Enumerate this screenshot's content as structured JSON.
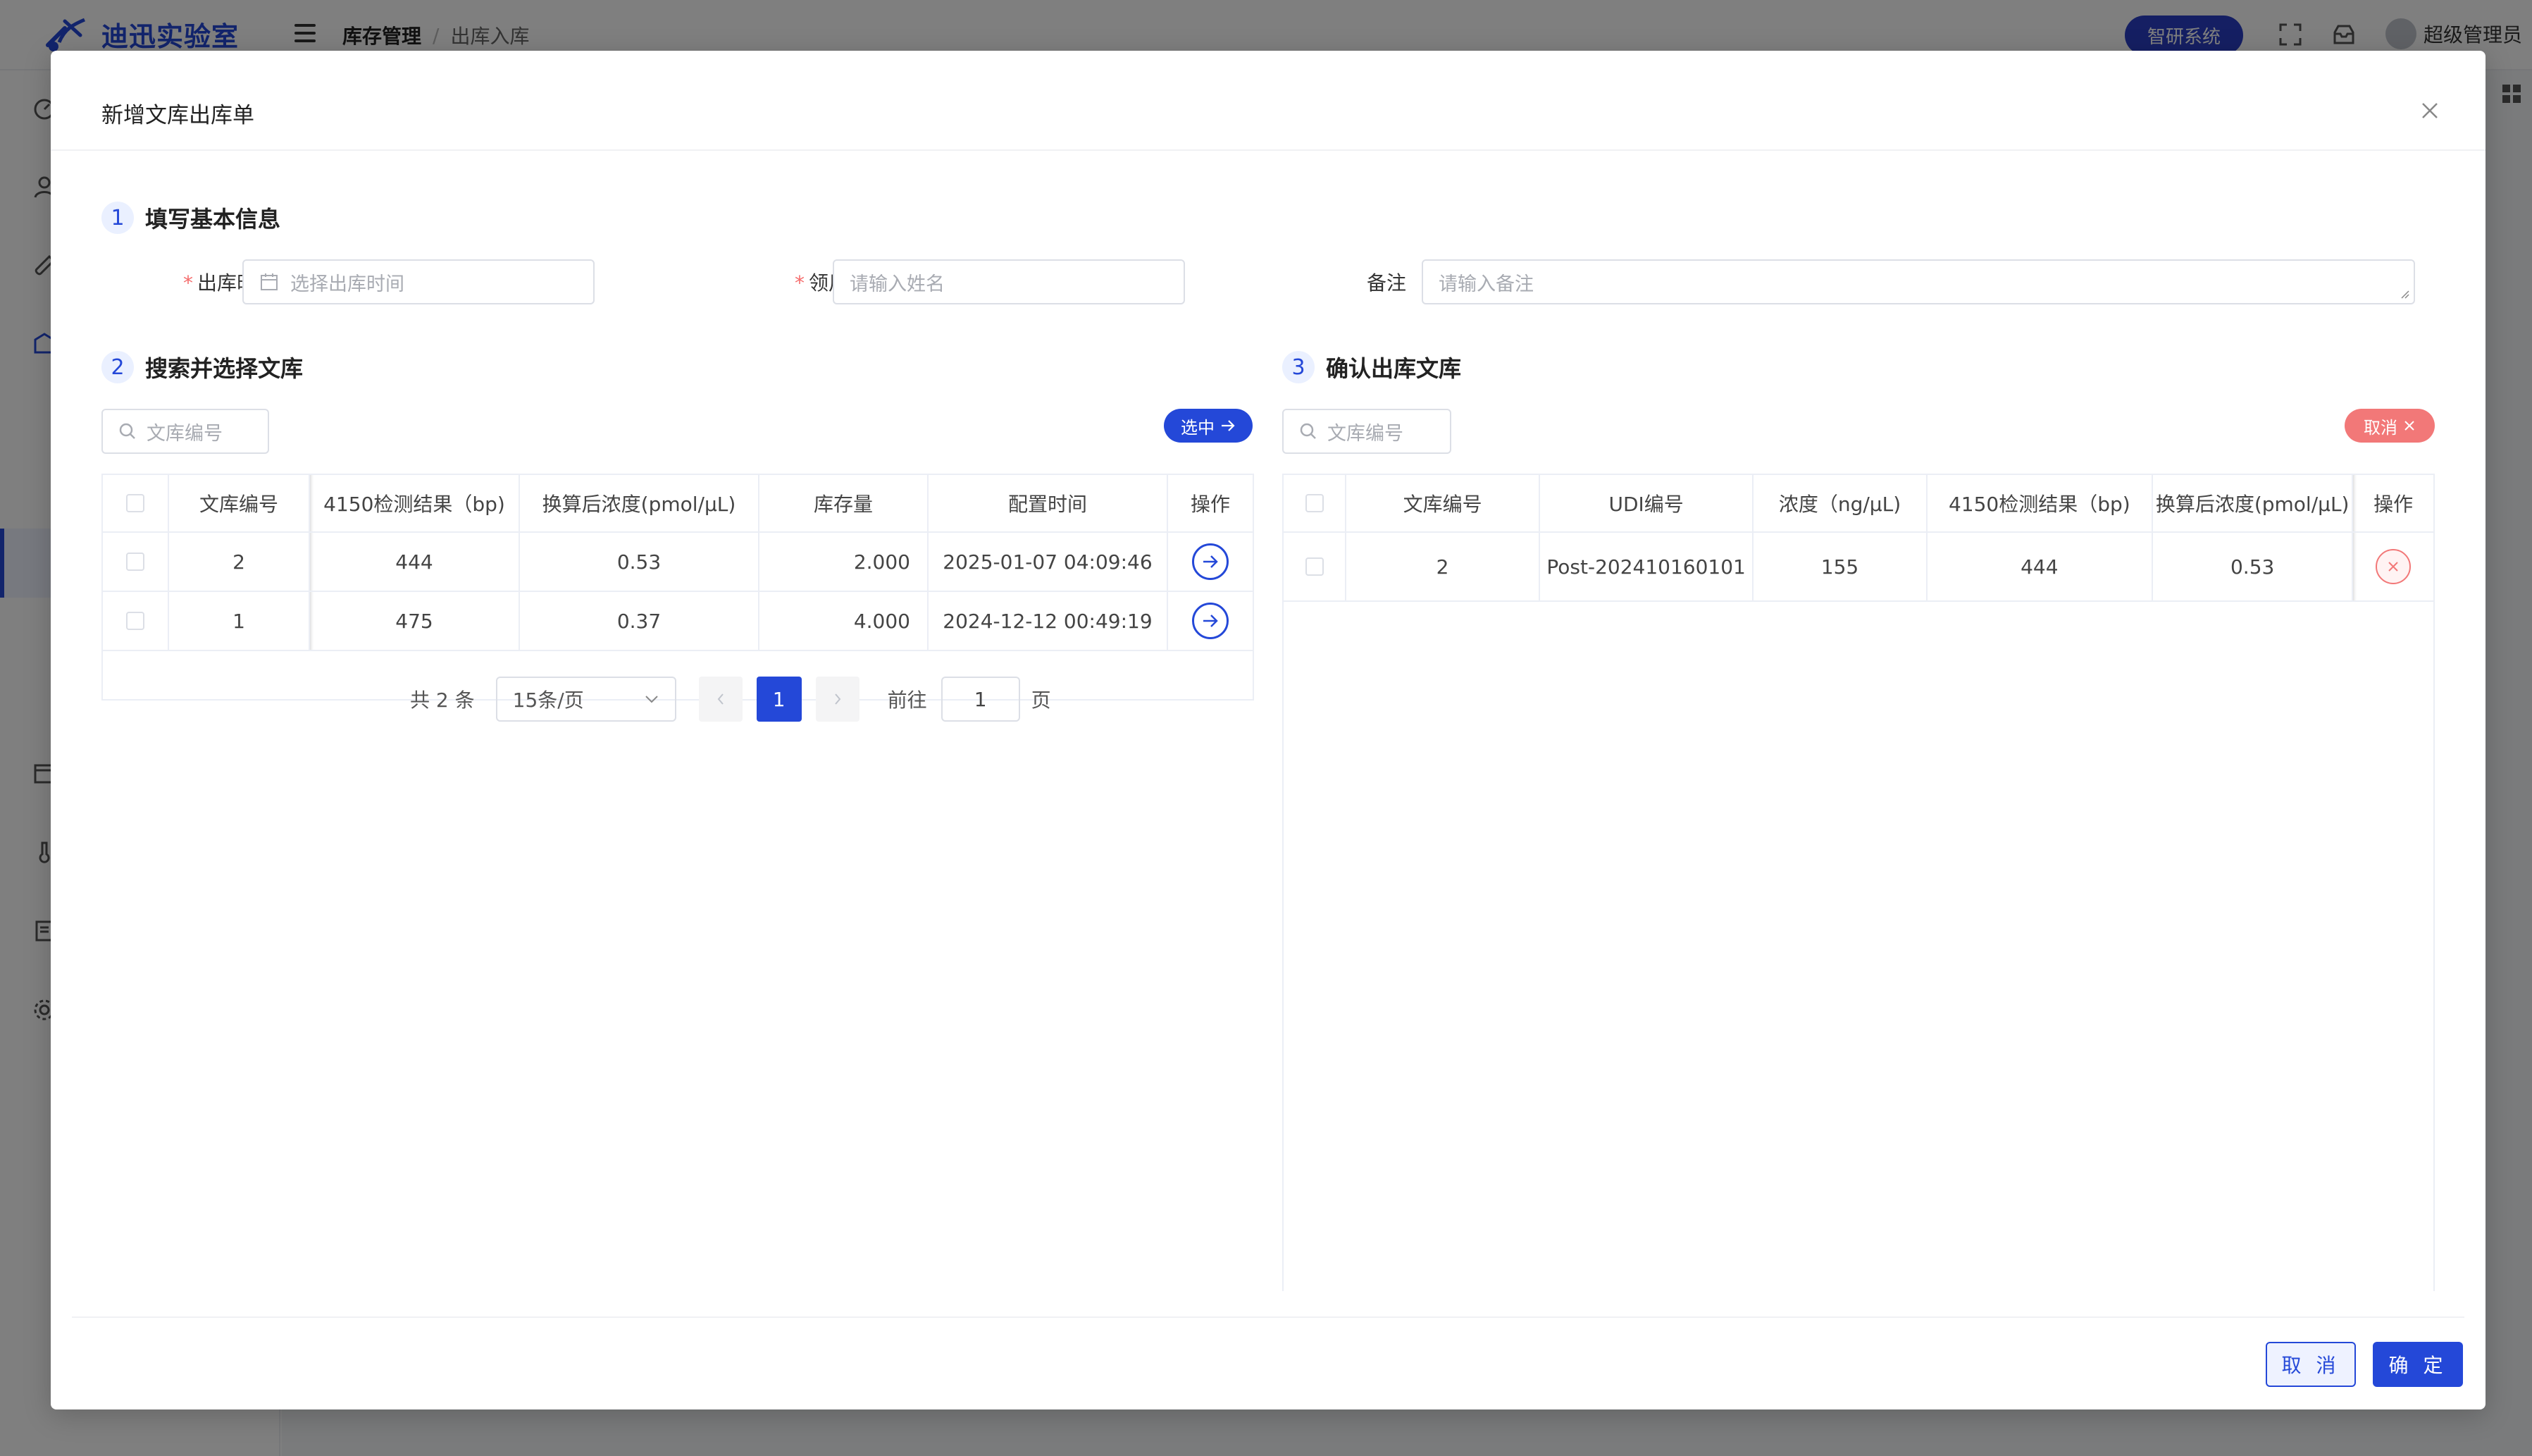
{
  "app": {
    "logo_text": "迪迅实验室",
    "breadcrumb": {
      "root": "库存管理",
      "separator": "/",
      "current": "出库入库"
    },
    "system_button": "智研系统",
    "user_name": "超级管理员"
  },
  "dialog": {
    "title": "新增文库出库单",
    "section1": {
      "step": "1",
      "title": "填写基本信息"
    },
    "form": {
      "out_time_label": "出库时间",
      "out_time_placeholder": "选择出库时间",
      "recipient_label": "领用人",
      "recipient_placeholder": "请输入姓名",
      "remark_label": "备注",
      "remark_placeholder": "请输入备注",
      "required_mark": "*"
    },
    "section2": {
      "step": "2",
      "title": "搜索并选择文库",
      "search_placeholder": "文库编号",
      "select_button": "选中",
      "columns": [
        "文库编号",
        "4150检测结果（bp)",
        "换算后浓度(pmol/μL)",
        "库存量",
        "配置时间",
        "操作"
      ],
      "rows": [
        {
          "id": "2",
          "result": "444",
          "conc": "0.53",
          "stock": "2.000",
          "time": "2025-01-07 04:09:46"
        },
        {
          "id": "1",
          "result": "475",
          "conc": "0.37",
          "stock": "4.000",
          "time": "2024-12-12 00:49:19"
        }
      ],
      "pagination": {
        "total": "共 2 条",
        "page_size": "15条/页",
        "current": "1",
        "goto_label": "前往",
        "goto_value": "1",
        "page_suffix": "页"
      }
    },
    "section3": {
      "step": "3",
      "title": "确认出库文库",
      "search_placeholder": "文库编号",
      "cancel_button": "取消",
      "columns": [
        "文库编号",
        "UDI编号",
        "浓度（ng/μL)",
        "4150检测结果（bp)",
        "换算后浓度(pmol/μL)",
        "操作"
      ],
      "rows": [
        {
          "id": "2",
          "udi": "Post-202410160101",
          "conc_ng": "155",
          "result": "444",
          "conc": "0.53"
        }
      ]
    },
    "footer": {
      "cancel": "取 消",
      "confirm": "确 定"
    }
  },
  "colors": {
    "primary": "#2448d8",
    "danger": "#f27878",
    "system_button": "#2a3fc7"
  }
}
